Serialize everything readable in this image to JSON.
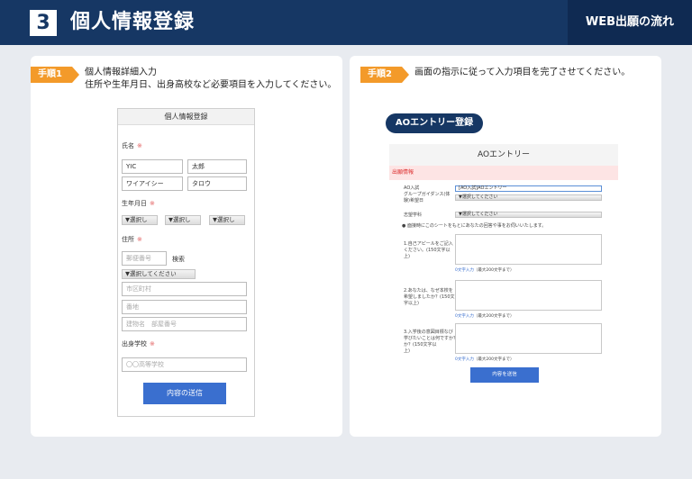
{
  "header": {
    "step_number": "3",
    "title": "個人情報登録",
    "right_label": "WEB出願の流れ"
  },
  "step1": {
    "tag": "手順1",
    "line1": "個人情報詳細入力",
    "line2": "住所や生年月日、出身高校など必要項目を入力してください。",
    "form": {
      "title": "個人情報登録",
      "name_label": "氏名",
      "required_mark": "※",
      "last_name": "YIC",
      "first_name": "太郎",
      "last_name_kana": "ワイアイシー",
      "first_name_kana": "タロウ",
      "birth_label": "生年月日",
      "select_short": "▼選択し",
      "address_label": "住所",
      "postal_placeholder": "郵便番号",
      "search_label": "検索",
      "select_pref": "▼選択してください",
      "city_placeholder": "市区町村",
      "street_placeholder": "番地",
      "building_placeholder": "建物名　部屋番号",
      "school_label": "出身学校",
      "school_placeholder": "〇〇高等学校",
      "submit_label": "内容の送信"
    }
  },
  "step2": {
    "tag": "手順2",
    "line1": "画面の指示に従って入力項目を完了させてください。",
    "pill": "AOエントリー登録",
    "form": {
      "title": "AOエントリー",
      "section": "出願情報",
      "q_guidance": "AO入試\nグループガイダンス(体\n験)希望日",
      "guidance_value": "[AO入試]AOエントリー",
      "select_placeholder": "▼選択してください",
      "q_department": "志望学科",
      "instruction": "● 面接時にこのシートをもとにあなたの回答や事をお伺いいたします。",
      "q1": "1.自己アピールをご記入\nください。(150文字以\n上)",
      "q2": "2.あなたは、なぜ本校を\n希望しましたか？(150文\n字以上)",
      "q3": "3.入学後の意図目標なび\n学びたいことは何ですか？\nか？(150文字以\n上)",
      "char_count_link": "0文字入力",
      "char_limit": "（最大200文字まで）",
      "submit_label": "内容を送信"
    }
  },
  "colors": {
    "navy": "#163764",
    "orange": "#f39a2a",
    "blue_button": "#3a6fcf",
    "required_red": "#e36060"
  }
}
